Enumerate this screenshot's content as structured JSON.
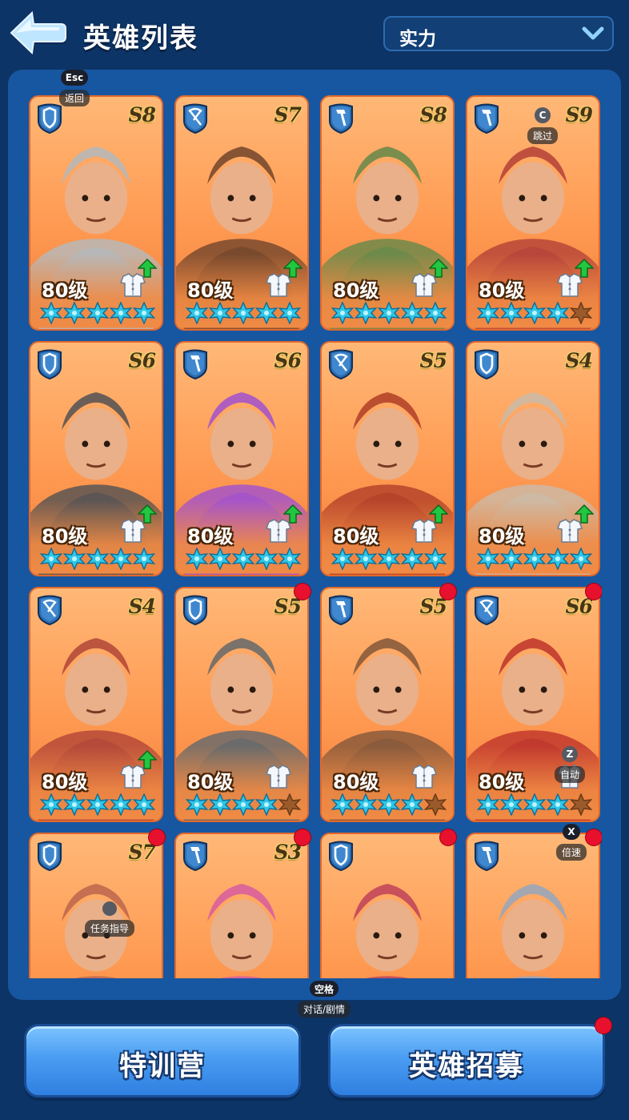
{
  "header": {
    "title": "英雄列表",
    "sort_label": "实力"
  },
  "hotkeys": [
    {
      "key": "Esc",
      "label": "返回"
    },
    {
      "key": "C",
      "label": "跳过"
    },
    {
      "key": "Z",
      "label": "自动"
    },
    {
      "key": "X",
      "label": "倍速"
    },
    {
      "key": "",
      "label": "任务指导"
    },
    {
      "key": "空格",
      "label": "对话/剧情"
    }
  ],
  "heroes": [
    {
      "class": "shield",
      "rank": "S8",
      "level": "80级",
      "stars_filled": 5,
      "upgrade": true,
      "red_dot": false,
      "theme": "#b7b7b7"
    },
    {
      "class": "crossbow",
      "rank": "S7",
      "level": "80级",
      "stars_filled": 5,
      "upgrade": true,
      "red_dot": false,
      "theme": "#7a4a2e"
    },
    {
      "class": "hammer",
      "rank": "S8",
      "level": "80级",
      "stars_filled": 5,
      "upgrade": true,
      "red_dot": false,
      "theme": "#6d8a4a"
    },
    {
      "class": "hammer",
      "rank": "S9",
      "level": "80级",
      "stars_filled": 4,
      "upgrade": true,
      "red_dot": false,
      "theme": "#b8463a"
    },
    {
      "class": "shield",
      "rank": "S6",
      "level": "80级",
      "stars_filled": 5,
      "upgrade": true,
      "red_dot": false,
      "theme": "#5b5554"
    },
    {
      "class": "hammer",
      "rank": "S6",
      "level": "80级",
      "stars_filled": 5,
      "upgrade": true,
      "red_dot": false,
      "theme": "#a655c9"
    },
    {
      "class": "crossbow",
      "rank": "S5",
      "level": "80级",
      "stars_filled": 5,
      "upgrade": true,
      "red_dot": false,
      "theme": "#b5442a"
    },
    {
      "class": "shield",
      "rank": "S4",
      "level": "80级",
      "stars_filled": 5,
      "upgrade": true,
      "red_dot": false,
      "theme": "#cdb9a4"
    },
    {
      "class": "crossbow",
      "rank": "S4",
      "level": "80级",
      "stars_filled": 5,
      "upgrade": true,
      "red_dot": false,
      "theme": "#b54a3a"
    },
    {
      "class": "shield",
      "rank": "S5",
      "level": "80级",
      "stars_filled": 4,
      "upgrade": false,
      "red_dot": true,
      "theme": "#6b6b6b"
    },
    {
      "class": "hammer",
      "rank": "S5",
      "level": "80级",
      "stars_filled": 4,
      "upgrade": false,
      "red_dot": true,
      "theme": "#8a5b3c"
    },
    {
      "class": "crossbow",
      "rank": "S6",
      "level": "80级",
      "stars_filled": 4,
      "upgrade": false,
      "red_dot": true,
      "theme": "#c23a2e"
    },
    {
      "class": "shield",
      "rank": "S7",
      "level": "",
      "stars_filled": 0,
      "upgrade": false,
      "red_dot": true,
      "theme": "#c0694f"
    },
    {
      "class": "hammer",
      "rank": "S3",
      "level": "",
      "stars_filled": 0,
      "upgrade": false,
      "red_dot": true,
      "theme": "#d95f9c"
    },
    {
      "class": "shield",
      "rank": "",
      "level": "",
      "stars_filled": 0,
      "upgrade": false,
      "red_dot": true,
      "theme": "#c2475a"
    },
    {
      "class": "hammer",
      "rank": "",
      "level": "",
      "stars_filled": 0,
      "upgrade": false,
      "red_dot": true,
      "theme": "#9aa6b8"
    }
  ],
  "buttons": {
    "training": "特训营",
    "recruit": "英雄招募",
    "recruit_red_dot": true
  },
  "colors": {
    "background": "#0d3466",
    "panel": "#1756a0",
    "card": "#ff9a52",
    "star_filled": "#2fc6e6",
    "star_empty": "#9a5a2a",
    "upgrade": "#22c640",
    "alert": "#e8112d"
  }
}
